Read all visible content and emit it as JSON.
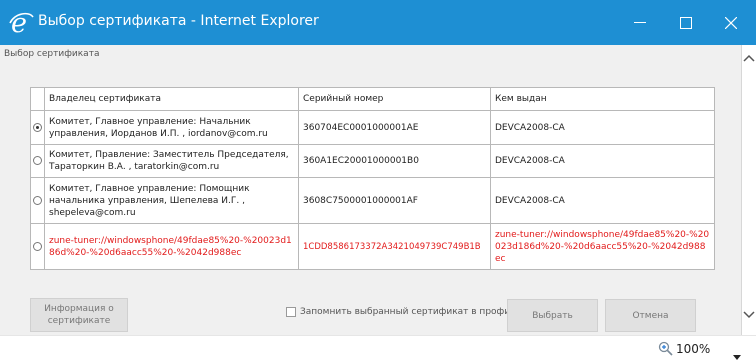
{
  "window": {
    "title": "Выбор сертификата - Internet Explorer",
    "icon": "ie-logo-icon",
    "controls": [
      "minimize-icon",
      "maximize-icon",
      "close-icon"
    ]
  },
  "dialog": {
    "title": "Выбор сертификата",
    "columns": [
      "Владелец сертификата",
      "Серийный номер",
      "Кем выдан"
    ],
    "rows": [
      {
        "selected": true,
        "owner": "Комитет, Главное управление: Начальник управления, Иорданов И.П. , iordanov@com.ru",
        "serial": "360704EC0001000001AE",
        "issuer": "DEVCA2008-CA"
      },
      {
        "selected": false,
        "owner": "Комитет, Правление: Заместитель Председателя, Тараторкин В.А. , taratorkin@com.ru",
        "serial": "360A1EC20001000001B0",
        "issuer": "DEVCA2008-CA"
      },
      {
        "selected": false,
        "owner": "Комитет, Главное управление: Помощник начальника управления, Шепелева И.Г. , shepeleva@com.ru",
        "serial": "3608C7500001000001AF",
        "issuer": "DEVCA2008-CA"
      },
      {
        "selected": false,
        "highlight_color": "#e21b1b",
        "owner": "zune-tuner://windowsphone/49fdae85%20-%20023d186d%20-%20d6aacc55%20-%2042d988ec",
        "serial": "1CDD8586173372A3421049739C749B1B",
        "issuer": "zune-tuner://windowsphone/49fdae85%20-%20023d186d%20-%20d6aacc55%20-%2042d988ec"
      }
    ],
    "info_button": "Информация о сертификате",
    "remember_label": "Запомнить выбранный сертификат в профиле",
    "remember_checked": false,
    "select_button": "Выбрать",
    "cancel_button": "Отмена"
  },
  "statusbar": {
    "zoom": "100%",
    "zoom_icon": "zoom-magnifier-icon"
  },
  "colors": {
    "titlebar": "#1e8fd3",
    "highlight": "#e21b1b"
  }
}
